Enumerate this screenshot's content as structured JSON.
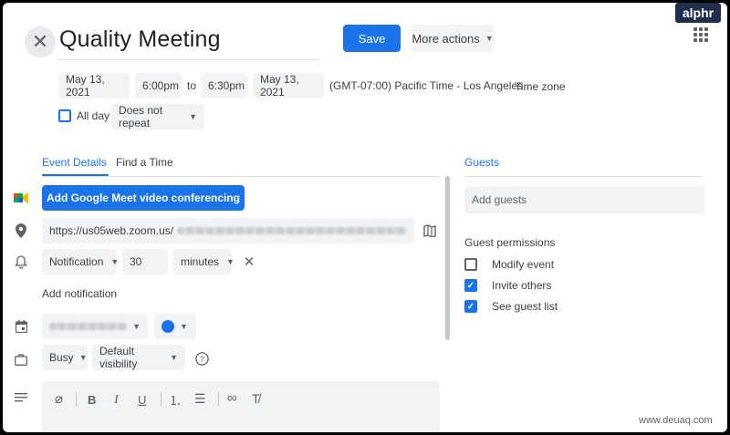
{
  "brand": {
    "logo_text": "alphr"
  },
  "header": {
    "title": "Quality Meeting",
    "save_label": "Save",
    "more_actions_label": "More actions"
  },
  "datetime": {
    "start_date": "May 13, 2021",
    "start_time": "6:00pm",
    "to_label": "to",
    "end_time": "6:30pm",
    "end_date": "May 13, 2021",
    "timezone_text": "(GMT-07:00) Pacific Time - Los Angeles",
    "timezone_link": "Time zone",
    "all_day_label": "All day",
    "repeat_label": "Does not repeat"
  },
  "tabs": {
    "event_details": "Event Details",
    "find_a_time": "Find a Time",
    "guests": "Guests"
  },
  "details": {
    "meet_button": "Add Google Meet video conferencing",
    "location_value": "https://us05web.zoom.us/",
    "notification_type": "Notification",
    "notification_amount": "30",
    "notification_unit": "minutes",
    "add_notification": "Add notification",
    "availability": "Busy",
    "visibility": "Default visibility"
  },
  "guests_panel": {
    "add_placeholder": "Add guests",
    "permissions_label": "Guest permissions",
    "permissions": [
      {
        "label": "Modify event",
        "checked": false
      },
      {
        "label": "Invite others",
        "checked": true
      },
      {
        "label": "See guest list",
        "checked": true
      }
    ]
  },
  "watermark": "www.deuaq.com",
  "colors": {
    "accent": "#1a73e8",
    "chip_bg": "#f1f3f4",
    "logo_bg": "#1f2f4b"
  }
}
